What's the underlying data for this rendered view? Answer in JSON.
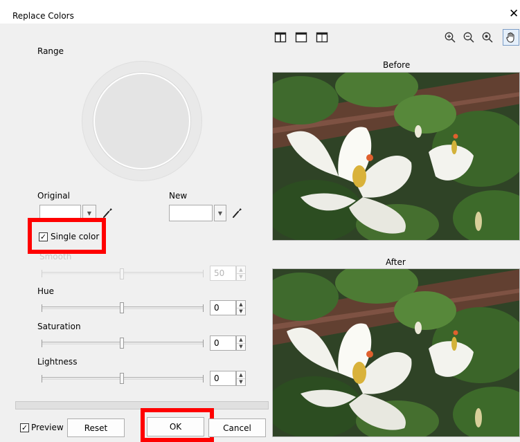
{
  "window": {
    "title": "Replace Colors",
    "close_glyph": "✕"
  },
  "range": {
    "label": "Range"
  },
  "original": {
    "label": "Original"
  },
  "new_color": {
    "label": "New"
  },
  "single_color": {
    "label": "Single color",
    "checked": true,
    "check_glyph": "✓"
  },
  "sliders": {
    "smooth": {
      "label": "Smooth",
      "value": "50",
      "disabled": true
    },
    "hue": {
      "label": "Hue",
      "value": "0"
    },
    "saturation": {
      "label": "Saturation",
      "value": "0"
    },
    "lightness": {
      "label": "Lightness",
      "value": "0"
    }
  },
  "footer": {
    "preview_label": "Preview",
    "preview_checked": true,
    "reset_label": "Reset",
    "ok_label": "OK",
    "cancel_label": "Cancel"
  },
  "preview_pane": {
    "before_label": "Before",
    "after_label": "After"
  },
  "icons": {
    "view_split_vertical": "split-vertical-view-icon",
    "view_single": "single-view-icon",
    "view_split_horizontal": "split-horizontal-view-icon",
    "zoom_in": "zoom-in-icon",
    "zoom_out": "zoom-out-icon",
    "zoom_fit": "zoom-fit-icon",
    "pan": "hand-pan-icon",
    "eyedropper": "eyedropper-icon"
  },
  "colors": {
    "highlight": "#ff0000",
    "swatch_original": "#ffffff",
    "swatch_new": "#ffffff"
  }
}
